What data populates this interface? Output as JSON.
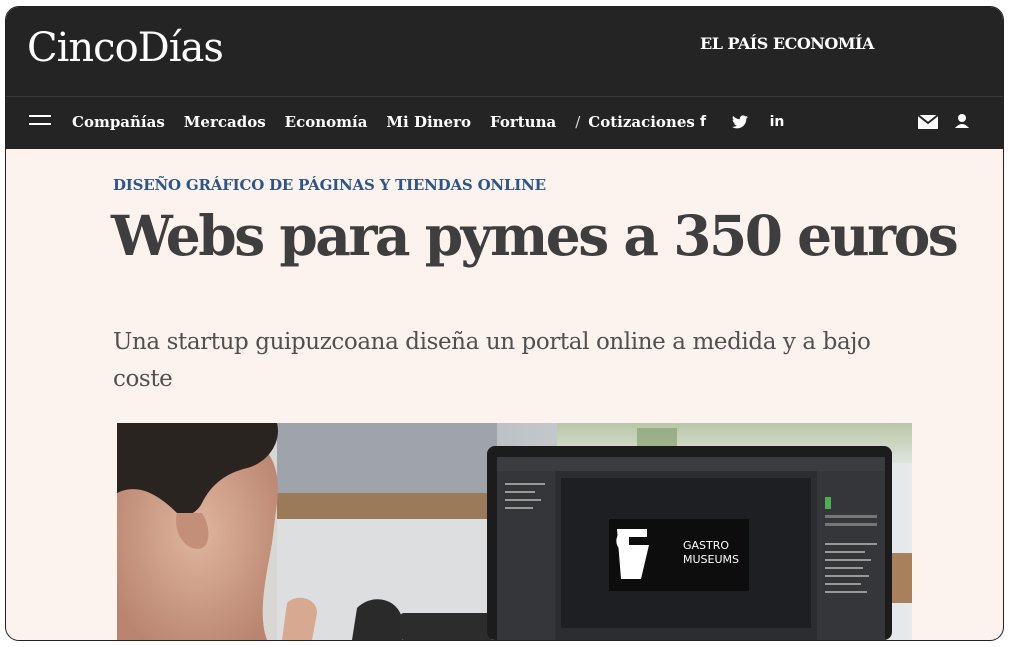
{
  "header": {
    "logo": "CincoDías",
    "partner": "EL PAÍS ECONOMÍA"
  },
  "nav": {
    "menu_icon": "hamburger-menu-icon",
    "items": [
      "Compañías",
      "Mercados",
      "Economía",
      "Mi Dinero",
      "Fortuna"
    ],
    "separator": "/",
    "quotes": "Cotizaciones",
    "social": [
      {
        "icon": "facebook-icon",
        "glyph": "f"
      },
      {
        "icon": "twitter-icon",
        "glyph": ""
      },
      {
        "icon": "linkedin-icon",
        "glyph": "in"
      }
    ],
    "mail_icon": "mail-icon",
    "user_icon": "user-icon"
  },
  "article": {
    "kicker": "DISEÑO GRÁFICO DE PÁGINAS Y TIENDAS ONLINE",
    "title": "Webs para pymes a 350 euros",
    "subtitle": "Una startup guipuzcoana diseña un portal online a medida y a bajo coste",
    "photo": {
      "screen_logo_line1": "GASTRO",
      "screen_logo_line2": "MUSEUMS"
    }
  },
  "colors": {
    "header_bg": "#242424",
    "page_bg": "#fdf3ee",
    "kicker": "#2d5588",
    "headline": "#3e3e3e"
  }
}
